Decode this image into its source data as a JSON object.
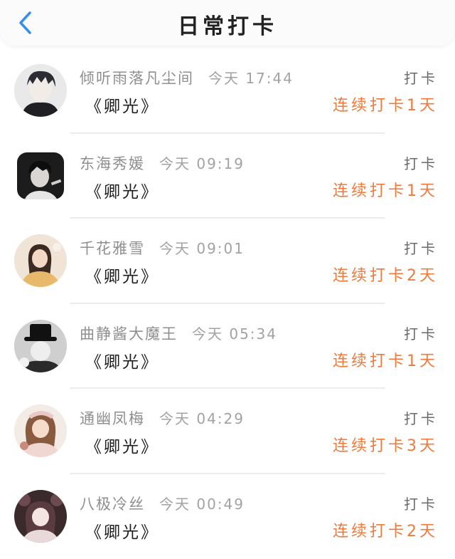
{
  "header": {
    "title": "日常打卡",
    "back_icon": "chevron-left-icon",
    "accent_color": "#3a8fe8"
  },
  "colors": {
    "streak": "#ee7a3c"
  },
  "entries": [
    {
      "user": "倾听雨落凡尘间",
      "time": "今天 17:44",
      "book": "《卿光》",
      "checkin": "打卡",
      "streak": "连续打卡1天"
    },
    {
      "user": "东海秀媛",
      "time": "今天 09:19",
      "book": "《卿光》",
      "checkin": "打卡",
      "streak": "连续打卡1天"
    },
    {
      "user": "千花雅雪",
      "time": "今天 09:01",
      "book": "《卿光》",
      "checkin": "打卡",
      "streak": "连续打卡2天"
    },
    {
      "user": "曲静酱大魔王",
      "time": "今天 05:34",
      "book": "《卿光》",
      "checkin": "打卡",
      "streak": "连续打卡1天"
    },
    {
      "user": "通幽凤梅",
      "time": "今天 04:29",
      "book": "《卿光》",
      "checkin": "打卡",
      "streak": "连续打卡3天"
    },
    {
      "user": "八极冷丝",
      "time": "今天 00:49",
      "book": "《卿光》",
      "checkin": "打卡",
      "streak": "连续打卡2天"
    }
  ]
}
